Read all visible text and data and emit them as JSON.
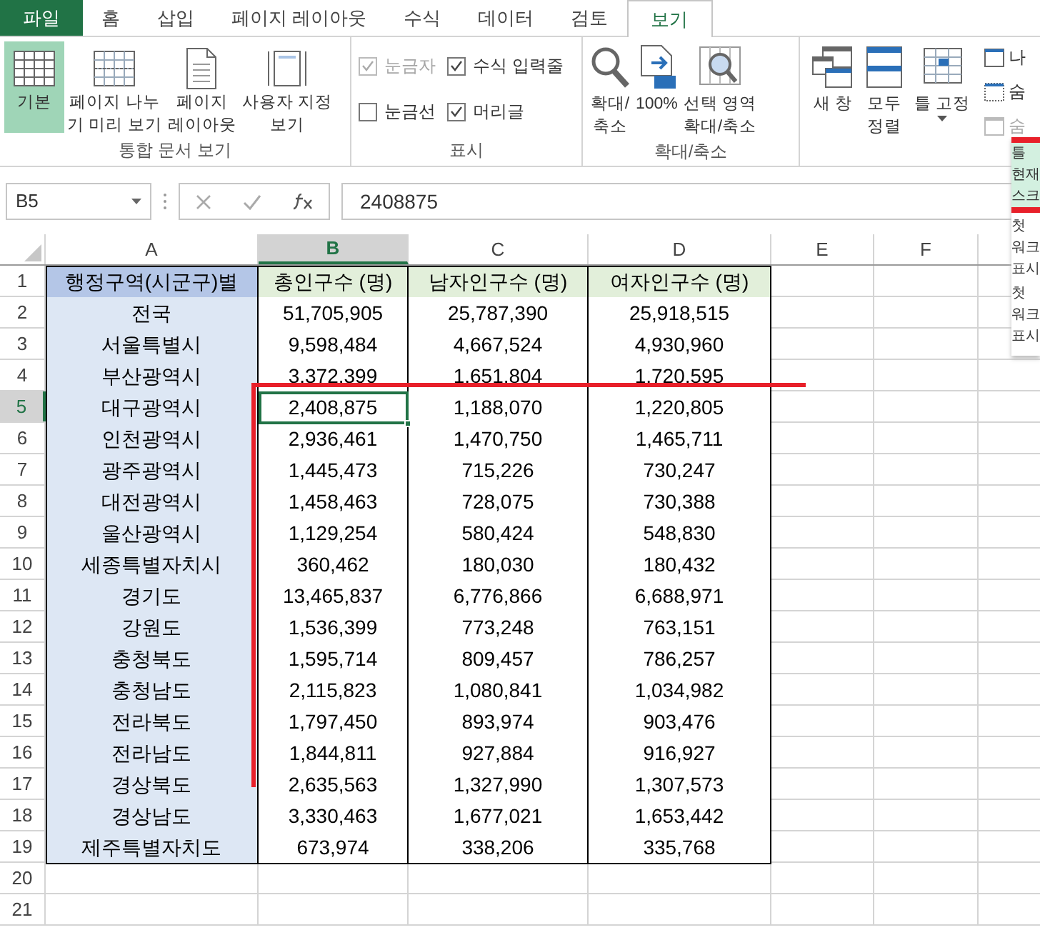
{
  "file_tab": {
    "label": "파일"
  },
  "tabs": [
    {
      "label": "홈",
      "selected": false
    },
    {
      "label": "삽입",
      "selected": false
    },
    {
      "label": "페이지 레이아웃",
      "selected": false
    },
    {
      "label": "수식",
      "selected": false
    },
    {
      "label": "데이터",
      "selected": false
    },
    {
      "label": "검토",
      "selected": false
    },
    {
      "label": "보기",
      "selected": true
    }
  ],
  "ribbon": {
    "workbook_views": {
      "label": "통합 문서 보기",
      "buttons": [
        {
          "label": "기본",
          "selected": true
        },
        {
          "label": "페이지 나누\n기 미리 보기",
          "selected": false
        },
        {
          "label": "페이지\n레이아웃",
          "selected": false
        },
        {
          "label": "사용자 지정\n보기",
          "selected": false
        }
      ]
    },
    "show": {
      "label": "표시",
      "checkboxes": [
        {
          "label": "눈금자",
          "checked": true,
          "disabled": true
        },
        {
          "label": "수식 입력줄",
          "checked": true,
          "disabled": false
        },
        {
          "label": "눈금선",
          "checked": false,
          "disabled": false
        },
        {
          "label": "머리글",
          "checked": true,
          "disabled": false
        }
      ]
    },
    "zoom": {
      "label": "확대/축소",
      "buttons": [
        {
          "label": "확대/\n축소"
        },
        {
          "label": "100%"
        },
        {
          "label": "선택 영역\n확대/축소"
        }
      ]
    },
    "window": {
      "buttons": [
        {
          "label": "새 창",
          "dropdown": false
        },
        {
          "label": "모두\n정렬",
          "dropdown": false
        },
        {
          "label": "틀 고정",
          "dropdown": true
        }
      ],
      "small": [
        {
          "label": "나",
          "disabled": false
        },
        {
          "label": "숨",
          "disabled": false
        },
        {
          "label": "숨",
          "disabled": true
        }
      ]
    }
  },
  "freeze_menu": [
    {
      "title": "틀",
      "lines": [
        "현재",
        "스크"
      ],
      "selected": true
    },
    {
      "title": "첫",
      "lines": [
        "워크",
        "표시"
      ],
      "selected": false
    },
    {
      "title": "첫",
      "lines": [
        "워크",
        "표시"
      ],
      "selected": false
    }
  ],
  "formula_bar": {
    "name_box": "B5",
    "value": "2408875"
  },
  "columns": [
    {
      "label": "A",
      "selected": false
    },
    {
      "label": "B",
      "selected": true
    },
    {
      "label": "C",
      "selected": false
    },
    {
      "label": "D",
      "selected": false
    },
    {
      "label": "E",
      "selected": false
    },
    {
      "label": "F",
      "selected": false
    }
  ],
  "rows": [
    {
      "label": "1",
      "kind": "header",
      "selected": false,
      "cells": [
        "행정구역(시군구)별",
        "총인구수 (명)",
        "남자인구수 (명)",
        "여자인구수 (명)"
      ]
    },
    {
      "label": "2",
      "kind": "data",
      "selected": false,
      "cells": [
        "전국",
        "51,705,905",
        "25,787,390",
        "25,918,515"
      ]
    },
    {
      "label": "3",
      "kind": "data",
      "selected": false,
      "cells": [
        "서울특별시",
        "9,598,484",
        "4,667,524",
        "4,930,960"
      ]
    },
    {
      "label": "4",
      "kind": "data",
      "selected": false,
      "cells": [
        "부산광역시",
        "3,372,399",
        "1,651,804",
        "1,720,595"
      ]
    },
    {
      "label": "5",
      "kind": "data",
      "selected": true,
      "cells": [
        "대구광역시",
        "2,408,875",
        "1,188,070",
        "1,220,805"
      ]
    },
    {
      "label": "6",
      "kind": "data",
      "selected": false,
      "cells": [
        "인천광역시",
        "2,936,461",
        "1,470,750",
        "1,465,711"
      ]
    },
    {
      "label": "7",
      "kind": "data",
      "selected": false,
      "cells": [
        "광주광역시",
        "1,445,473",
        "715,226",
        "730,247"
      ]
    },
    {
      "label": "8",
      "kind": "data",
      "selected": false,
      "cells": [
        "대전광역시",
        "1,458,463",
        "728,075",
        "730,388"
      ]
    },
    {
      "label": "9",
      "kind": "data",
      "selected": false,
      "cells": [
        "울산광역시",
        "1,129,254",
        "580,424",
        "548,830"
      ]
    },
    {
      "label": "10",
      "kind": "data",
      "selected": false,
      "cells": [
        "세종특별자치시",
        "360,462",
        "180,030",
        "180,432"
      ]
    },
    {
      "label": "11",
      "kind": "data",
      "selected": false,
      "cells": [
        "경기도",
        "13,465,837",
        "6,776,866",
        "6,688,971"
      ]
    },
    {
      "label": "12",
      "kind": "data",
      "selected": false,
      "cells": [
        "강원도",
        "1,536,399",
        "773,248",
        "763,151"
      ]
    },
    {
      "label": "13",
      "kind": "data",
      "selected": false,
      "cells": [
        "충청북도",
        "1,595,714",
        "809,457",
        "786,257"
      ]
    },
    {
      "label": "14",
      "kind": "data",
      "selected": false,
      "cells": [
        "충청남도",
        "2,115,823",
        "1,080,841",
        "1,034,982"
      ]
    },
    {
      "label": "15",
      "kind": "data",
      "selected": false,
      "cells": [
        "전라북도",
        "1,797,450",
        "893,974",
        "903,476"
      ]
    },
    {
      "label": "16",
      "kind": "data",
      "selected": false,
      "cells": [
        "전라남도",
        "1,844,811",
        "927,884",
        "916,927"
      ]
    },
    {
      "label": "17",
      "kind": "data",
      "selected": false,
      "cells": [
        "경상북도",
        "2,635,563",
        "1,327,990",
        "1,307,573"
      ]
    },
    {
      "label": "18",
      "kind": "data",
      "selected": false,
      "cells": [
        "경상남도",
        "3,330,463",
        "1,677,021",
        "1,653,442"
      ]
    },
    {
      "label": "19",
      "kind": "data",
      "selected": false,
      "cells": [
        "제주특별자치도",
        "673,974",
        "338,206",
        "335,768"
      ]
    },
    {
      "label": "20",
      "kind": "empty",
      "selected": false,
      "cells": []
    },
    {
      "label": "21",
      "kind": "empty",
      "selected": false,
      "cells": []
    }
  ]
}
